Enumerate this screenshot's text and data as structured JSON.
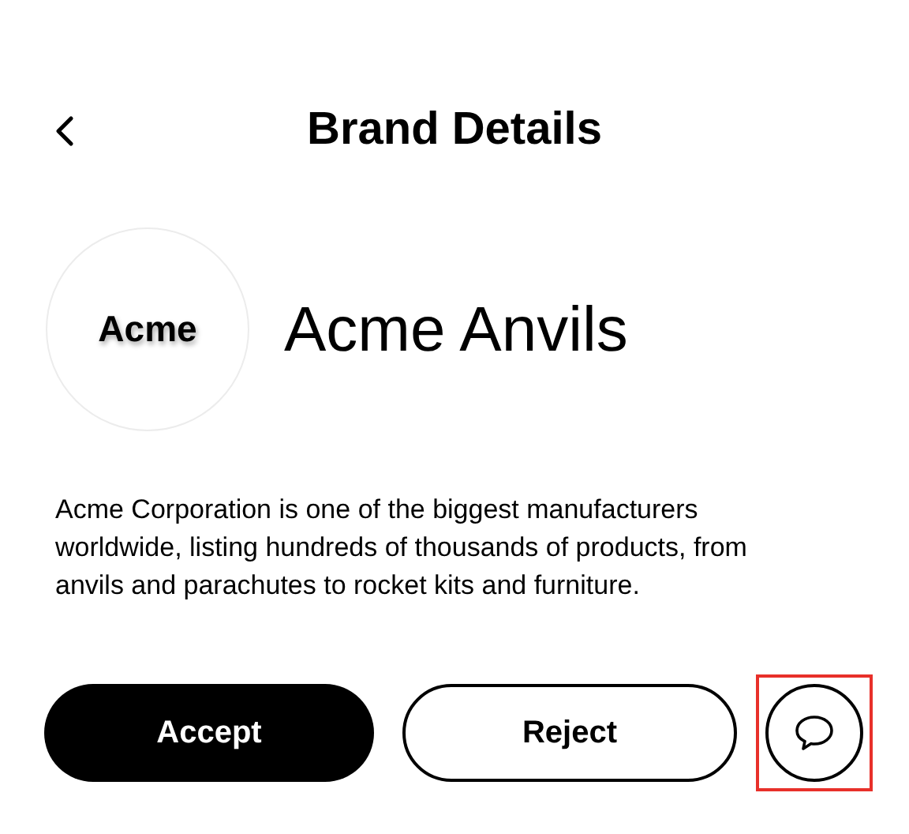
{
  "header": {
    "title": "Brand Details"
  },
  "brand": {
    "logo_text": "Acme",
    "name": "Acme Anvils",
    "description": "Acme Corporation is one of the biggest manufacturers worldwide, listing hundreds of thousands of products, from anvils and parachutes to rocket kits and furniture."
  },
  "actions": [
    {
      "kind": "primary",
      "label": "Accept"
    },
    {
      "kind": "secondary",
      "label": "Reject"
    },
    {
      "kind": "chat",
      "highlighted": true
    }
  ]
}
